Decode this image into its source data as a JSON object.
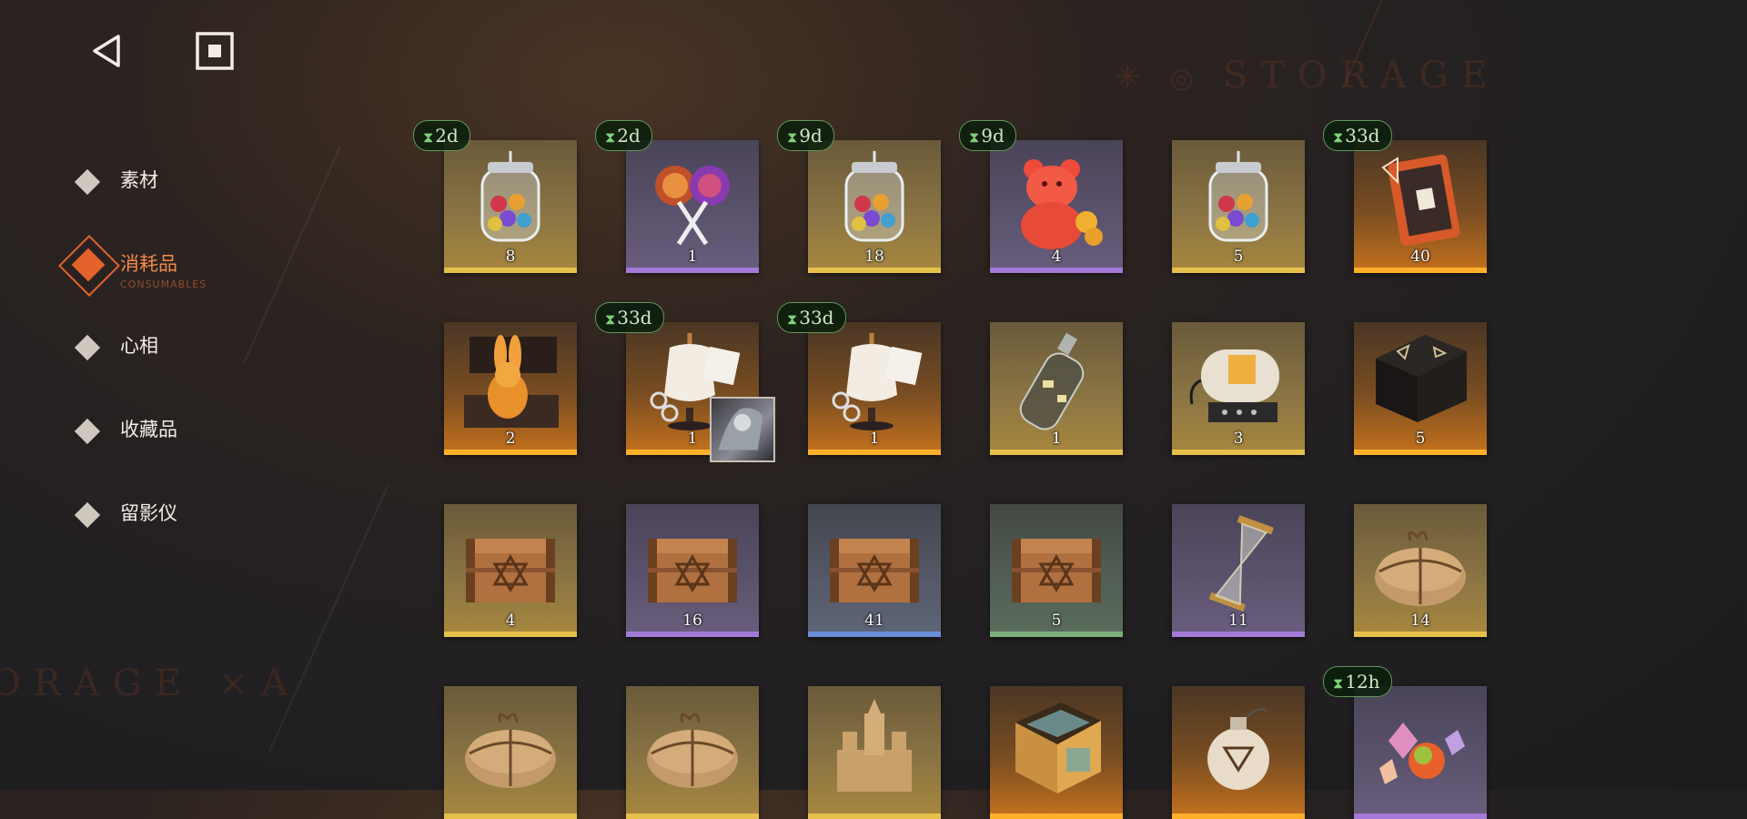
{
  "nav": {
    "back_icon": "back-triangle-icon",
    "stop_icon": "square-stop-icon"
  },
  "background": {
    "storage_text": "STORAGE",
    "storage_text_2": "ORAGE ×A"
  },
  "sidebar": {
    "items": [
      {
        "label": "素材",
        "icon": "diamond-icon",
        "active": false
      },
      {
        "label": "消耗品",
        "sub": "CONSUMABLES",
        "icon": "diamond-icon",
        "active": true
      },
      {
        "label": "心相",
        "icon": "diamond-icon",
        "active": false
      },
      {
        "label": "收藏品",
        "icon": "diamond-icon",
        "active": false
      },
      {
        "label": "留影仪",
        "icon": "diamond-icon",
        "active": false
      }
    ]
  },
  "colors": {
    "accent": "#e2622a",
    "rarity_gold": "#e6c04a",
    "rarity_purple": "#a47ad8",
    "rarity_orange": "#ffb02a",
    "rarity_blue": "#6a8ed8",
    "rarity_green": "#7ab07a",
    "timer_green": "#7ed07a"
  },
  "items": [
    {
      "icon": "candy-jar-icon",
      "qty": "8",
      "timer": "2d",
      "rarity": "gold"
    },
    {
      "icon": "lollipop-icon",
      "qty": "1",
      "timer": "2d",
      "rarity": "purple"
    },
    {
      "icon": "candy-jar-icon",
      "qty": "18",
      "timer": "9d",
      "rarity": "gold"
    },
    {
      "icon": "gummy-bear-icon",
      "qty": "4",
      "timer": "9d",
      "rarity": "purple"
    },
    {
      "icon": "candy-jar-icon",
      "qty": "5",
      "timer": "",
      "rarity": "gold"
    },
    {
      "icon": "rune-book-icon",
      "qty": "40",
      "timer": "33d",
      "rarity": "orange"
    },
    {
      "icon": "rabbit-box-icon",
      "qty": "2",
      "timer": "",
      "rarity": "orange"
    },
    {
      "icon": "tailor-mannequin-icon",
      "qty": "1",
      "timer": "33d",
      "rarity": "orange",
      "thumb": "character-portrait-icon"
    },
    {
      "icon": "tailor-mannequin-icon",
      "qty": "1",
      "timer": "33d",
      "rarity": "orange"
    },
    {
      "icon": "message-bottle-icon",
      "qty": "1",
      "timer": "",
      "rarity": "gold"
    },
    {
      "icon": "capsule-machine-icon",
      "qty": "3",
      "timer": "",
      "rarity": "gold"
    },
    {
      "icon": "rune-crate-icon",
      "qty": "5",
      "timer": "",
      "rarity": "orange"
    },
    {
      "icon": "wooden-crate-icon",
      "qty": "4",
      "timer": "",
      "rarity": "gold"
    },
    {
      "icon": "wooden-crate-icon",
      "qty": "16",
      "timer": "",
      "rarity": "purple"
    },
    {
      "icon": "wooden-crate-icon",
      "qty": "41",
      "timer": "",
      "rarity": "blue"
    },
    {
      "icon": "wooden-crate-icon",
      "qty": "5",
      "timer": "",
      "rarity": "green"
    },
    {
      "icon": "hourglass-icon",
      "qty": "11",
      "timer": "",
      "rarity": "purple"
    },
    {
      "icon": "parcel-icon",
      "qty": "14",
      "timer": "",
      "rarity": "gold"
    },
    {
      "icon": "parcel-icon",
      "qty": "",
      "timer": "",
      "rarity": "gold"
    },
    {
      "icon": "parcel-icon",
      "qty": "",
      "timer": "",
      "rarity": "gold"
    },
    {
      "icon": "sand-castle-icon",
      "qty": "",
      "timer": "",
      "rarity": "gold"
    },
    {
      "icon": "framed-tile-icon",
      "qty": "",
      "timer": "",
      "rarity": "orange"
    },
    {
      "icon": "pouch-icon",
      "qty": "",
      "timer": "",
      "rarity": "orange"
    },
    {
      "icon": "gem-candies-icon",
      "qty": "",
      "timer": "12h",
      "rarity": "purple"
    }
  ]
}
